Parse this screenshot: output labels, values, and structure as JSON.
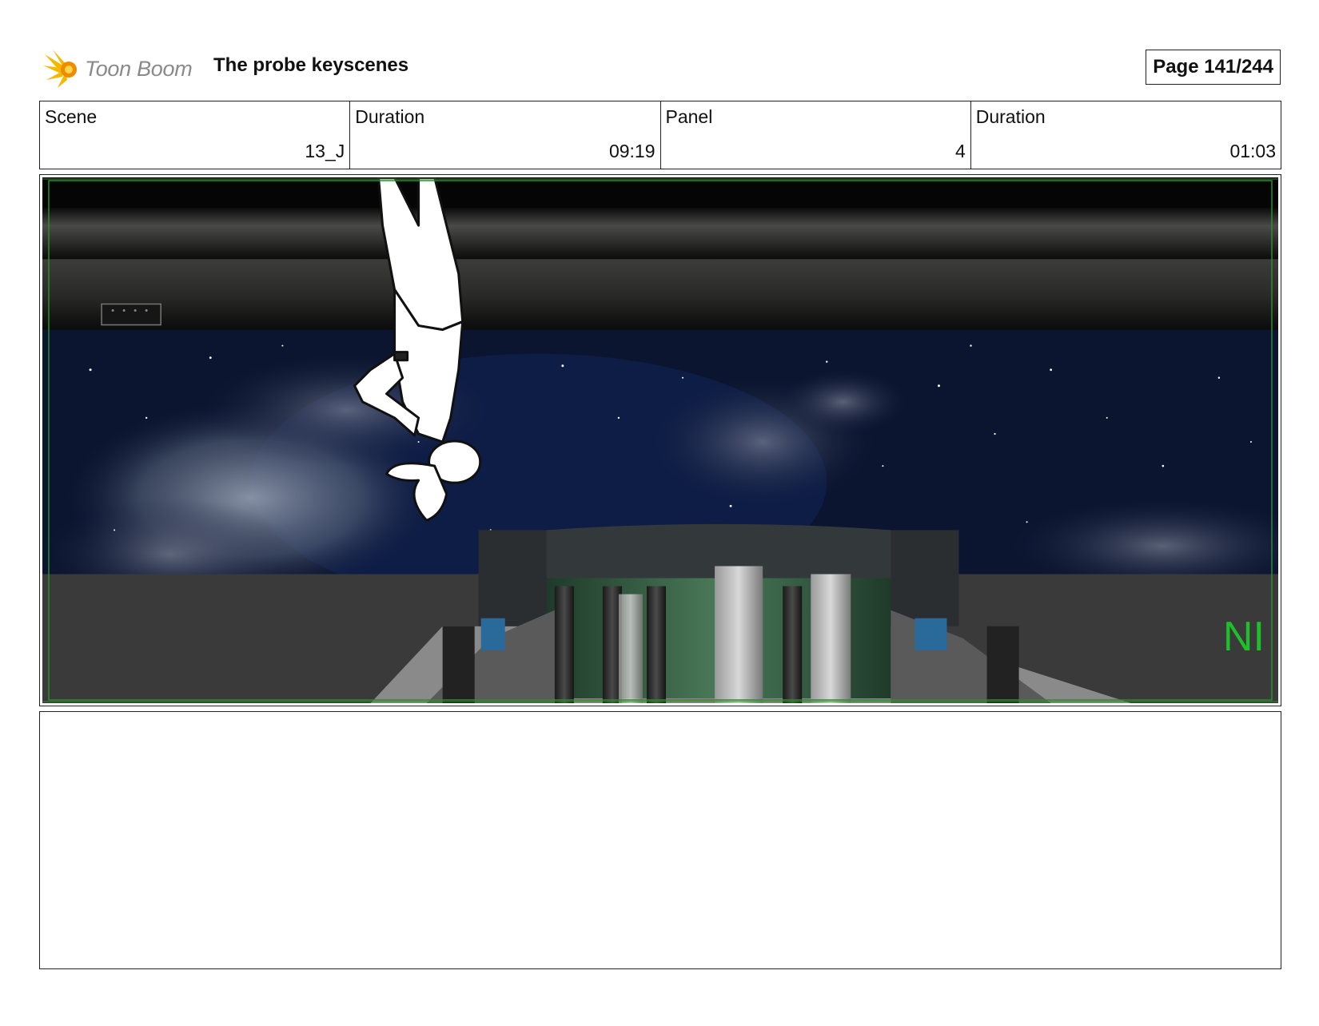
{
  "header": {
    "logo_text": "Toon Boom",
    "title": "The probe keyscenes",
    "page": "Page 141/244"
  },
  "info": [
    {
      "label": "Scene",
      "value": "13_J"
    },
    {
      "label": "Duration",
      "value": "09:19"
    },
    {
      "label": "Panel",
      "value": "4"
    },
    {
      "label": "Duration",
      "value": "01:03"
    }
  ],
  "panel": {
    "overlay_text": "NI",
    "overlay_color": "#1fbf2a",
    "guide_color": "#2e8b2e"
  },
  "notes": ""
}
